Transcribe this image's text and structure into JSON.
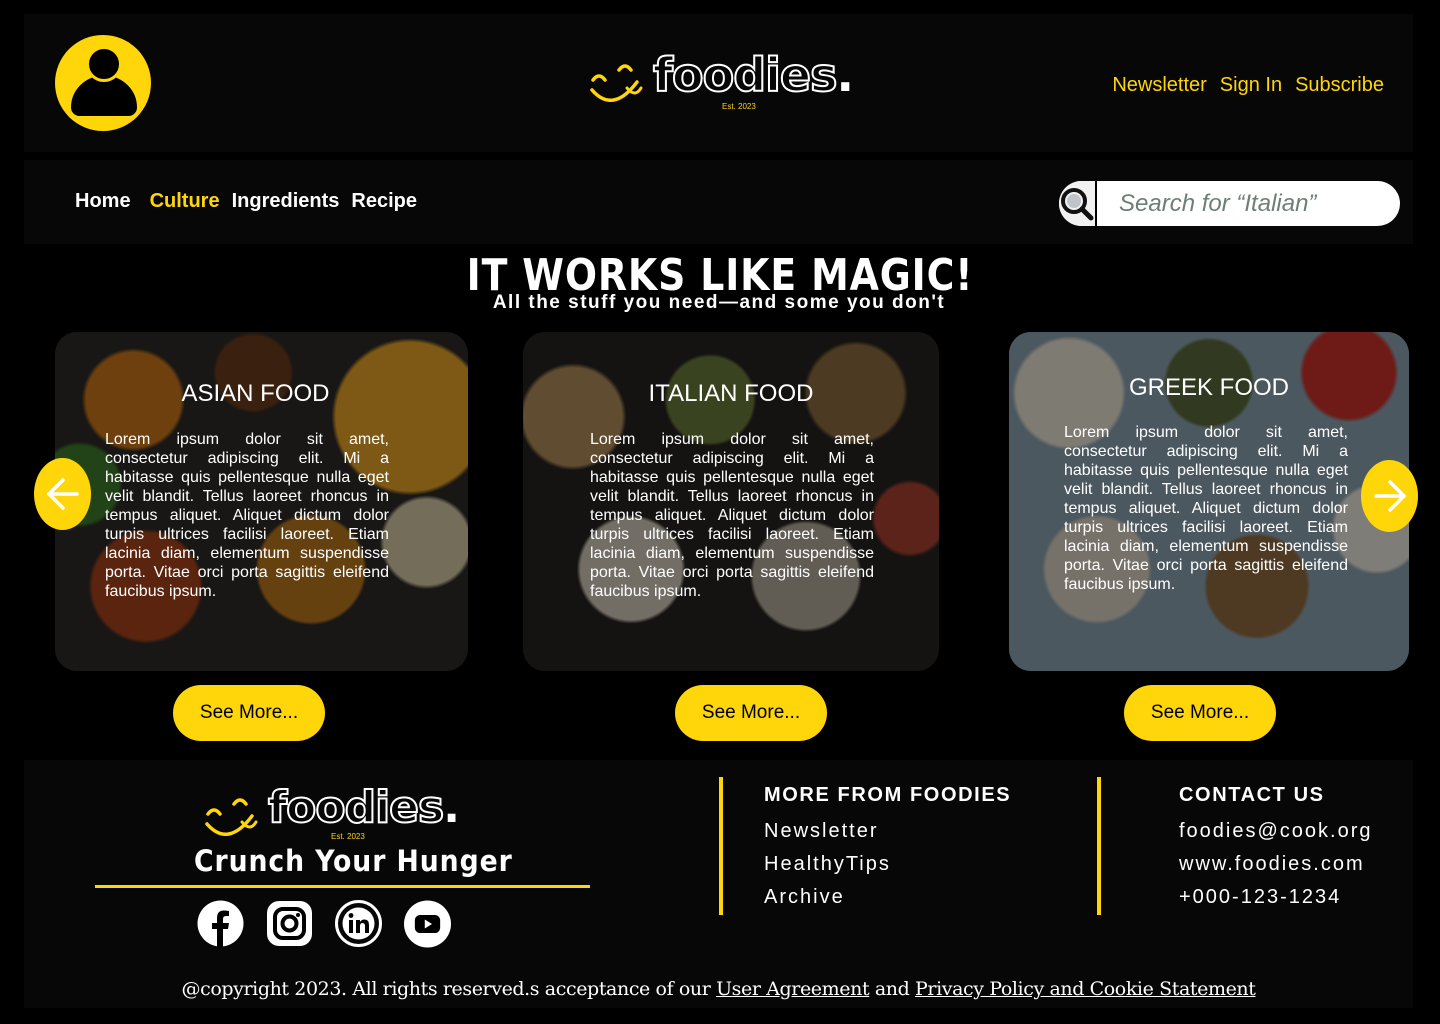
{
  "brand": {
    "name": "foodies",
    "est": "Est. 2023"
  },
  "header": {
    "links": [
      "Newsletter",
      "Sign In",
      "Subscribe"
    ]
  },
  "nav": {
    "items": [
      "Home",
      "Culture",
      "Ingredients",
      "Recipe"
    ],
    "active": "Culture"
  },
  "search": {
    "placeholder": "Search for “Italian”"
  },
  "hero": {
    "title": "IT WORKS LIKE MAGIC!",
    "subtitle": "All the stuff you need—and some you don't"
  },
  "cards": [
    {
      "title": "ASIAN FOOD",
      "text": "Lorem ipsum dolor sit amet, consectetur adipiscing elit. Mi a habitasse quis pellentesque nulla eget velit blandit. Tellus laoreet rhoncus in tempus aliquet. Aliquet dictum dolor turpis ultrices facilisi laoreet. Etiam lacinia diam, elementum suspendisse porta. Vitae orci porta sagittis eleifend faucibus ipsum.",
      "button": "See More..."
    },
    {
      "title": "ITALIAN FOOD",
      "text": "Lorem ipsum dolor sit amet, consectetur adipiscing elit. Mi a habitasse quis pellentesque nulla eget velit blandit. Tellus laoreet rhoncus in tempus aliquet. Aliquet dictum dolor turpis ultrices facilisi laoreet. Etiam lacinia diam, elementum suspendisse porta. Vitae orci porta sagittis eleifend faucibus ipsum.",
      "button": "See More..."
    },
    {
      "title": "GREEK FOOD",
      "text": "Lorem ipsum dolor sit amet, consectetur adipiscing elit. Mi a habitasse quis pellentesque nulla eget velit blandit. Tellus laoreet rhoncus in tempus aliquet. Aliquet dictum dolor turpis ultrices facilisi laoreet. Etiam lacinia diam, elementum suspendisse porta. Vitae orci porta sagittis eleifend faucibus ipsum.",
      "button": "See More..."
    }
  ],
  "footer": {
    "tagline": "Crunch Your Hunger",
    "socials": [
      "facebook-icon",
      "instagram-icon",
      "linkedin-icon",
      "youtube-icon"
    ],
    "more_heading": "MORE FROM FOODIES",
    "more_links": [
      "Newsletter",
      "HealthyTips",
      "Archive"
    ],
    "contact_heading": "CONTACT US",
    "contact_items": [
      "foodies@cook.org",
      "www.foodies.com",
      "+000-123-1234"
    ],
    "copyright_prefix": "@copyright 2023. All rights reserved.s acceptance of our ",
    "user_agreement": "User Agreement",
    "and": " and ",
    "privacy": "Privacy Policy and Cookie Statement"
  },
  "colors": {
    "accent": "#FFD60A",
    "background": "#000000",
    "panel": "#070707"
  }
}
